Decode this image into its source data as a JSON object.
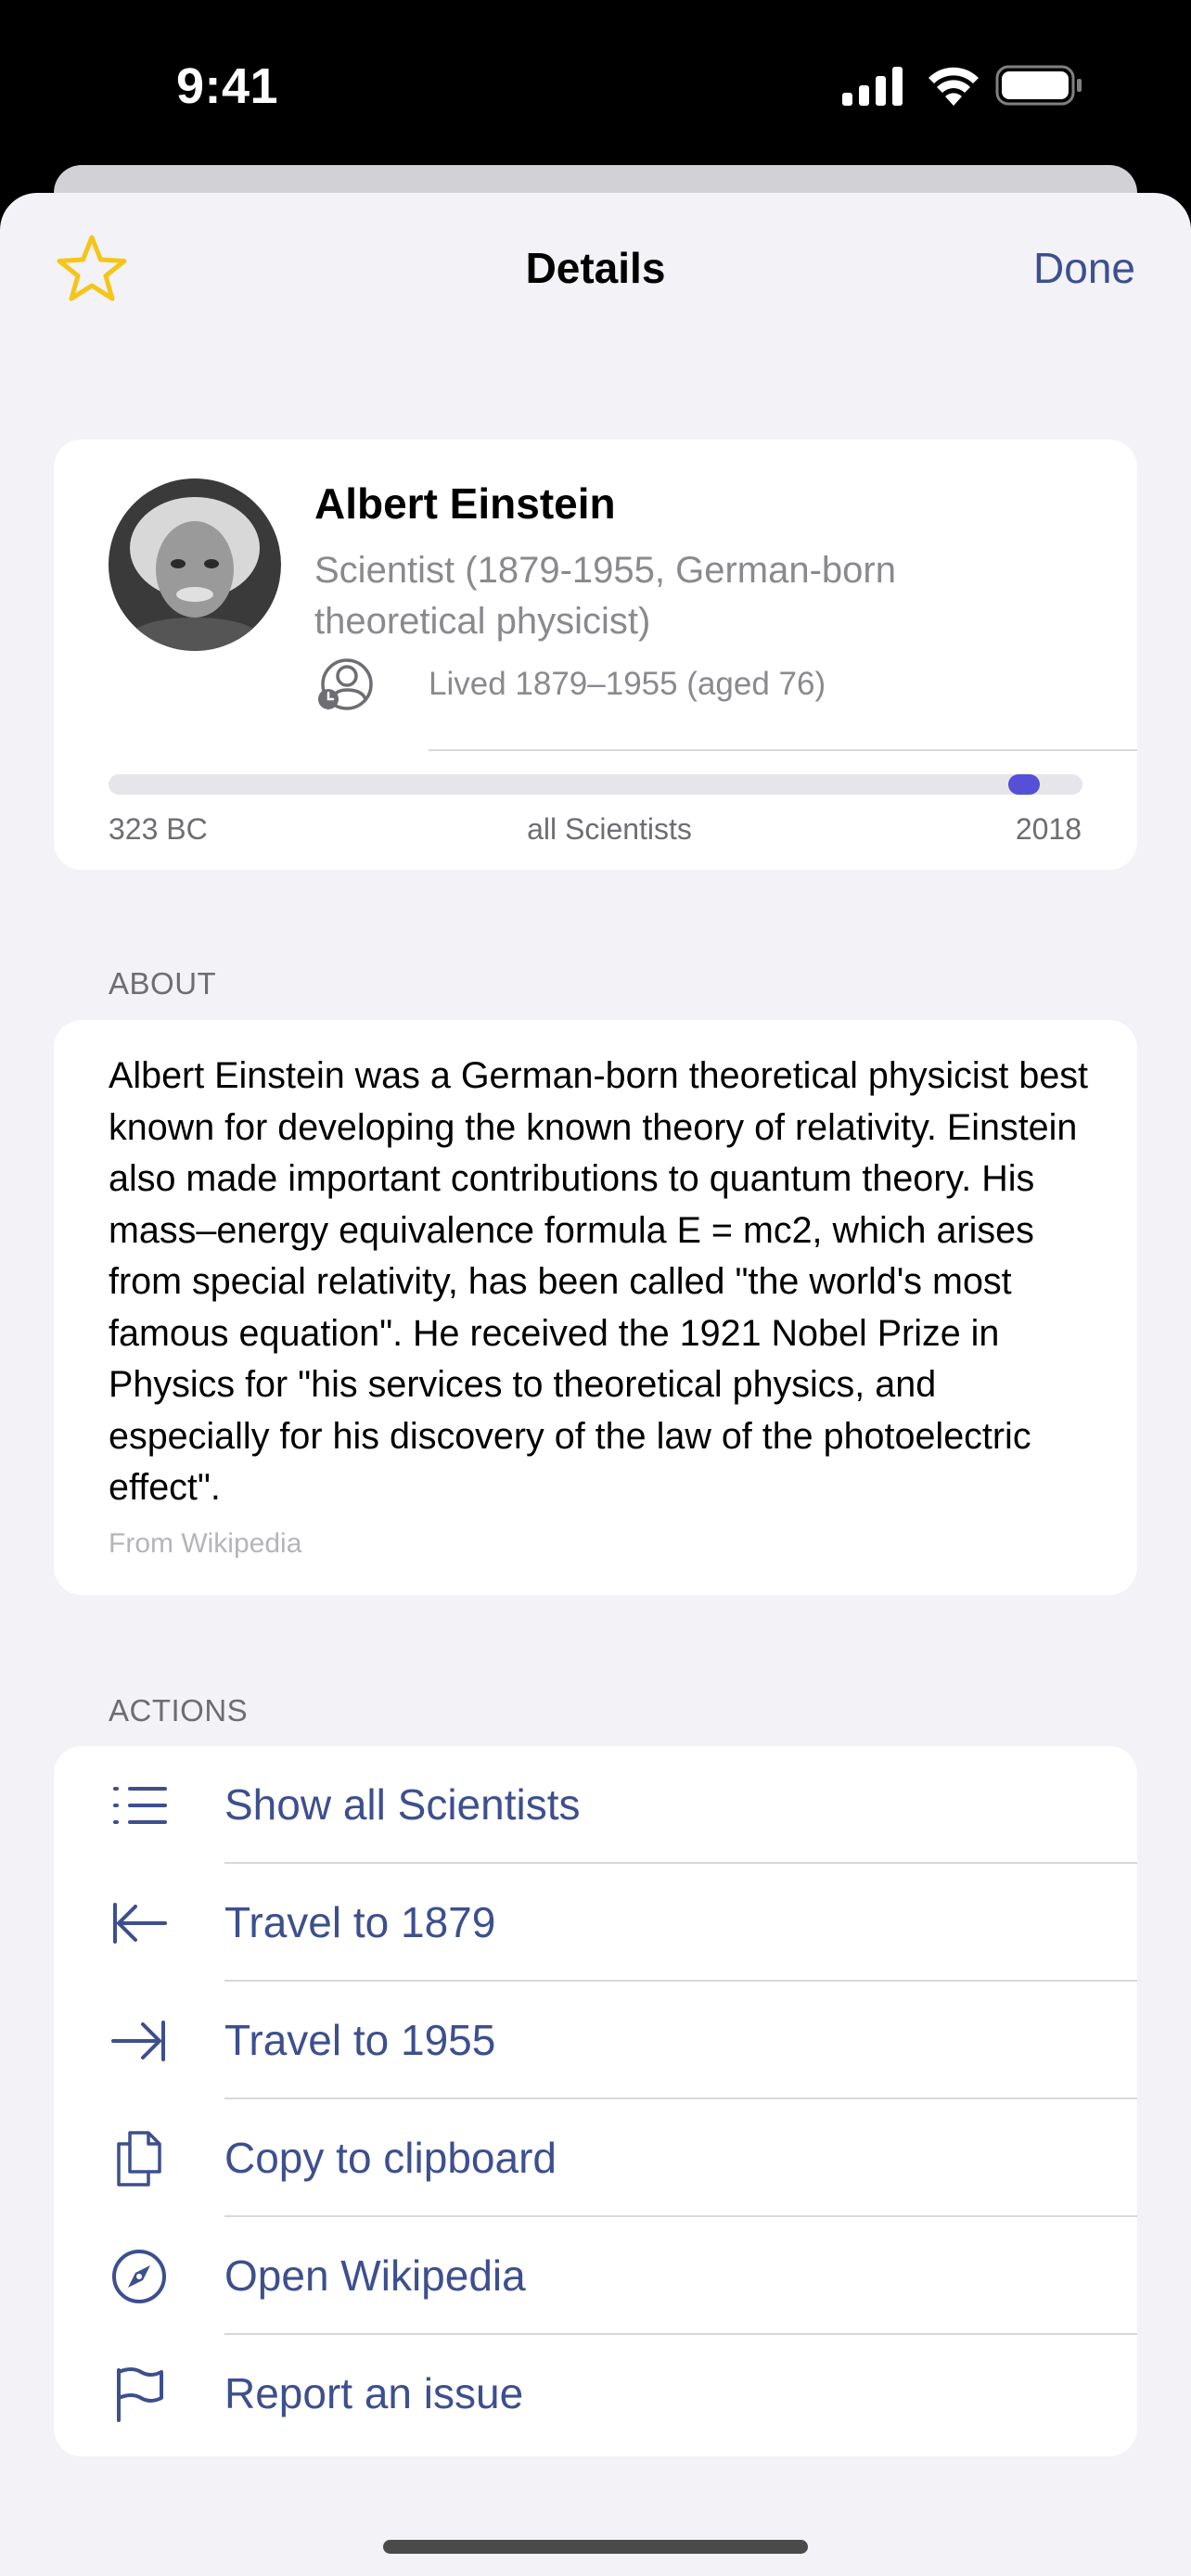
{
  "status_bar": {
    "time": "9:41"
  },
  "nav": {
    "title": "Details",
    "done_label": "Done"
  },
  "person": {
    "name": "Albert Einstein",
    "description": "Scientist (1879-1955, German-born theoretical physicist)",
    "lifespan": "Lived 1879–1955 (aged 76)"
  },
  "timeline": {
    "start_label": "323 BC",
    "middle_label": "all Scientists",
    "end_label": "2018",
    "position": 0.955
  },
  "about": {
    "header": "ABOUT",
    "text": "Albert Einstein was a German-born theoretical physicist best known for developing the known theory of relativity. Einstein also made important contributions to quantum theory. His mass–energy equivalence formula E = mc2, which arises from special relativity, has been called \"the world's most famous equation\". He received the 1921 Nobel Prize in Physics for \"his services to theoretical physics, and especially for his discovery of the law of the photoelectric effect\".",
    "source": "From Wikipedia"
  },
  "actions": {
    "header": "ACTIONS",
    "items": [
      {
        "label": "Show all Scientists",
        "icon": "list-icon"
      },
      {
        "label": "Travel to 1879",
        "icon": "arrow-left-to-line-icon"
      },
      {
        "label": "Travel to 1955",
        "icon": "arrow-right-to-line-icon"
      },
      {
        "label": "Copy to clipboard",
        "icon": "copy-icon"
      },
      {
        "label": "Open Wikipedia",
        "icon": "compass-icon"
      },
      {
        "label": "Report an issue",
        "icon": "flag-icon"
      }
    ]
  },
  "colors": {
    "accent": "#3d4f8e",
    "star": "#f5c518",
    "timeline_thumb": "#5550d6",
    "background": "#f2f2f7"
  }
}
